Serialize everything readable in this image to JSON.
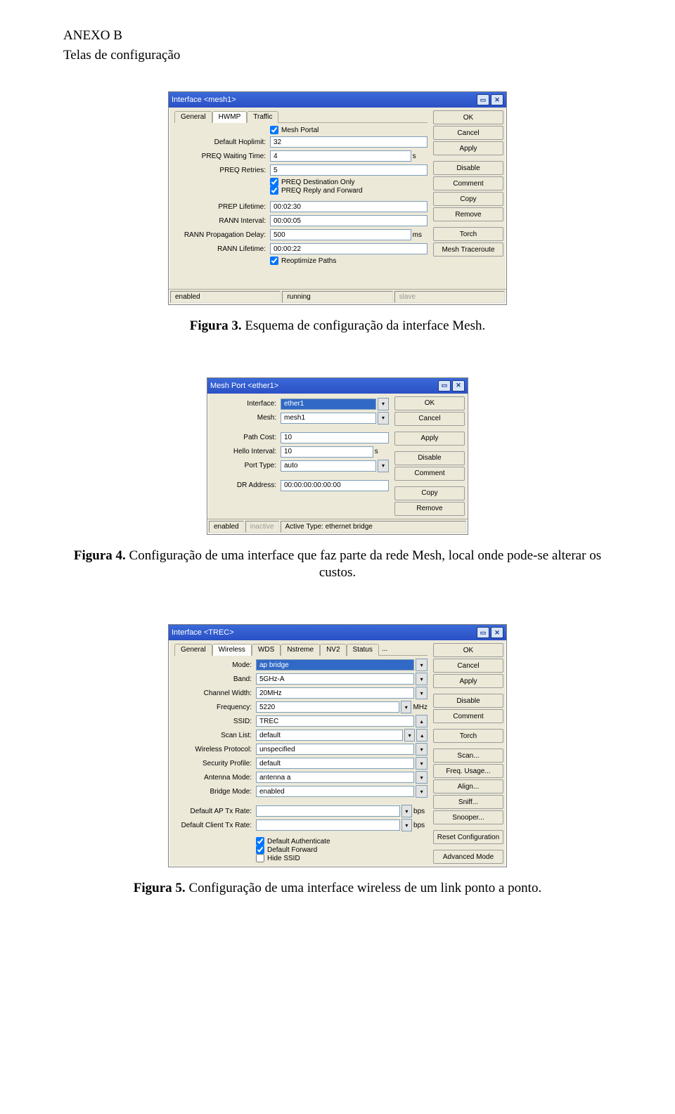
{
  "page": {
    "heading": "ANEXO B",
    "subheading": "Telas de configuração"
  },
  "captions": {
    "fig3_prefix": "Figura 3. ",
    "fig3_text": "Esquema de configuração da interface Mesh.",
    "fig4_prefix": "Figura 4. ",
    "fig4_text": "Configuração de uma interface que faz parte da rede Mesh, local onde pode-se alterar os custos.",
    "fig5_prefix": "Figura 5. ",
    "fig5_text": "Configuração de uma interface wireless de um link ponto a ponto."
  },
  "fig1": {
    "title": "Interface <mesh1>",
    "tabs": {
      "general": "General",
      "hwmp": "HWMP",
      "traffic": "Traffic"
    },
    "labels": {
      "mesh_portal": "Mesh Portal",
      "default_hoplimit": "Default Hoplimit:",
      "preq_waiting": "PREQ Waiting Time:",
      "preq_retries": "PREQ Retries:",
      "preq_dest_only": "PREQ Destination Only",
      "preq_reply_fwd": "PREQ Reply and Forward",
      "prep_lifetime": "PREP Lifetime:",
      "rann_interval": "RANN Interval:",
      "rann_prop_delay": "RANN Propagation Delay:",
      "rann_lifetime": "RANN Lifetime:",
      "reoptimize": "Reoptimize Paths",
      "unit_s": "s",
      "unit_ms": "ms"
    },
    "values": {
      "default_hoplimit": "32",
      "preq_waiting": "4",
      "preq_retries": "5",
      "prep_lifetime": "00:02:30",
      "rann_interval": "00:00:05",
      "rann_prop_delay": "500",
      "rann_lifetime": "00:00:22"
    },
    "buttons": {
      "ok": "OK",
      "cancel": "Cancel",
      "apply": "Apply",
      "disable": "Disable",
      "comment": "Comment",
      "copy": "Copy",
      "remove": "Remove",
      "torch": "Torch",
      "mesh_tr": "Mesh Traceroute"
    },
    "status": {
      "enabled": "enabled",
      "running": "running",
      "slave": "slave"
    }
  },
  "fig2": {
    "title": "Mesh Port <ether1>",
    "labels": {
      "interface": "Interface:",
      "mesh": "Mesh:",
      "path_cost": "Path Cost:",
      "hello_interval": "Hello Interval:",
      "port_type": "Port Type:",
      "dr_address": "DR Address:",
      "unit_s": "s"
    },
    "values": {
      "interface": "ether1",
      "mesh": "mesh1",
      "path_cost": "10",
      "hello_interval": "10",
      "port_type": "auto",
      "dr_address": "00:00:00:00:00:00"
    },
    "buttons": {
      "ok": "OK",
      "cancel": "Cancel",
      "apply": "Apply",
      "disable": "Disable",
      "comment": "Comment",
      "copy": "Copy",
      "remove": "Remove"
    },
    "status": {
      "enabled": "enabled",
      "inactive": "inactive",
      "active_type": "Active Type: ethernet bridge"
    }
  },
  "fig3": {
    "title": "Interface <TREC>",
    "tabs": {
      "general": "General",
      "wireless": "Wireless",
      "wds": "WDS",
      "nstreme": "Nstreme",
      "nv2": "NV2",
      "status": "Status",
      "more": "..."
    },
    "labels": {
      "mode": "Mode:",
      "band": "Band:",
      "channel_width": "Channel Width:",
      "frequency": "Frequency:",
      "ssid": "SSID:",
      "scan_list": "Scan List:",
      "wireless_protocol": "Wireless Protocol:",
      "security_profile": "Security Profile:",
      "antenna_mode": "Antenna Mode:",
      "bridge_mode": "Bridge Mode:",
      "default_ap_tx": "Default AP Tx Rate:",
      "default_client_tx": "Default Client Tx Rate:",
      "default_authenticate": "Default Authenticate",
      "default_forward": "Default Forward",
      "hide_ssid": "Hide SSID",
      "unit_mhz": "MHz",
      "unit_bps": "bps"
    },
    "values": {
      "mode": "ap bridge",
      "band": "5GHz-A",
      "channel_width": "20MHz",
      "frequency": "5220",
      "ssid": "TREC",
      "scan_list": "default",
      "wireless_protocol": "unspecified",
      "security_profile": "default",
      "antenna_mode": "antenna a",
      "bridge_mode": "enabled",
      "default_ap_tx": "",
      "default_client_tx": ""
    },
    "buttons": {
      "ok": "OK",
      "cancel": "Cancel",
      "apply": "Apply",
      "disable": "Disable",
      "comment": "Comment",
      "torch": "Torch",
      "scan": "Scan...",
      "freq_usage": "Freq. Usage...",
      "align": "Align...",
      "sniff": "Sniff...",
      "snooper": "Snooper...",
      "reset_config": "Reset Configuration",
      "advanced": "Advanced Mode"
    }
  }
}
